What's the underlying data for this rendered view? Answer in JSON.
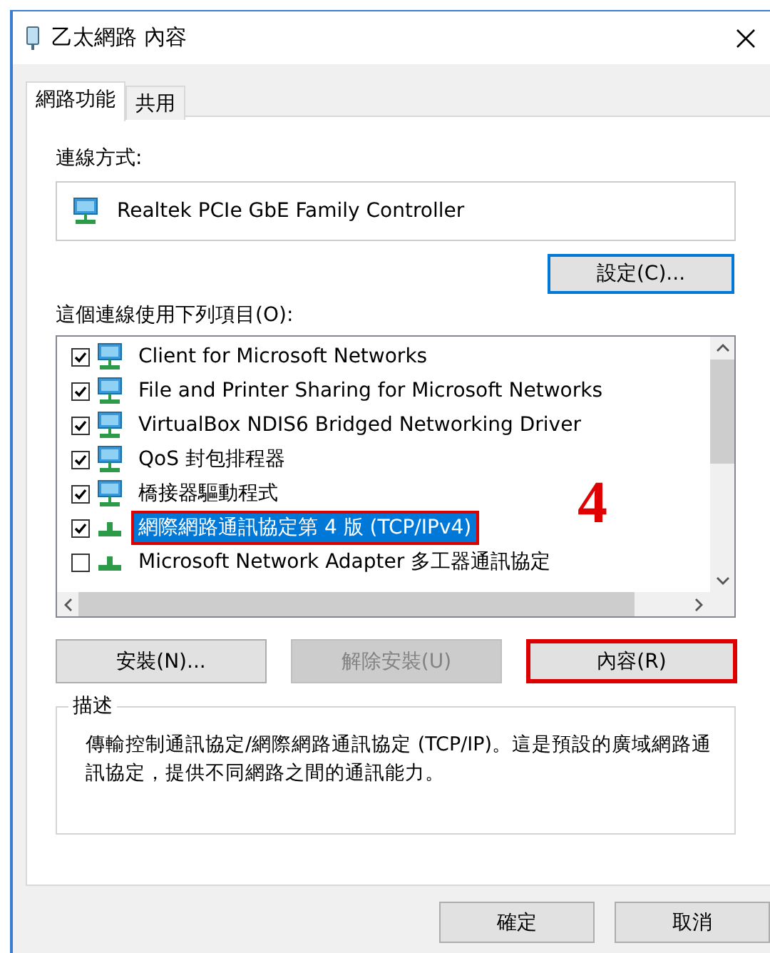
{
  "window": {
    "title": "乙太網路 內容"
  },
  "tabs": [
    {
      "label": "網路功能",
      "selected": true
    },
    {
      "label": "共用",
      "selected": false
    }
  ],
  "connect_using": {
    "label": "連線方式:",
    "adapter": "Realtek PCIe GbE Family Controller",
    "button": "設定(C)..."
  },
  "items": {
    "label": "這個連線使用下列項目(O):",
    "rows": [
      {
        "name": "Client for Microsoft Networks",
        "checked": true,
        "selected": false,
        "highlighted": false,
        "kind": "monitor"
      },
      {
        "name": "File and Printer Sharing for Microsoft Networks",
        "checked": true,
        "selected": false,
        "highlighted": false,
        "kind": "monitor"
      },
      {
        "name": "VirtualBox NDIS6 Bridged Networking Driver",
        "checked": true,
        "selected": false,
        "highlighted": false,
        "kind": "monitor"
      },
      {
        "name": "QoS 封包排程器",
        "checked": true,
        "selected": false,
        "highlighted": false,
        "kind": "monitor"
      },
      {
        "name": "橋接器驅動程式",
        "checked": true,
        "selected": false,
        "highlighted": false,
        "kind": "monitor"
      },
      {
        "name": "網際網路通訊協定第 4 版 (TCP/IPv4)",
        "checked": true,
        "selected": true,
        "highlighted": true,
        "kind": "protocol"
      },
      {
        "name": "Microsoft Network Adapter 多工器通訊協定",
        "checked": false,
        "selected": false,
        "highlighted": false,
        "kind": "protocol"
      }
    ]
  },
  "buttons": [
    {
      "label": "安裝(N)...",
      "disabled": false,
      "highlighted": false
    },
    {
      "label": "解除安裝(U)",
      "disabled": true,
      "highlighted": false
    },
    {
      "label": "內容(R)",
      "disabled": false,
      "highlighted": true
    }
  ],
  "description": {
    "label": "描述",
    "text": "傳輸控制通訊協定/網際網路通訊協定 (TCP/IP)。這是預設的廣域網路通訊協定，提供不同網路之間的通訊能力。"
  },
  "annotation": {
    "label": "4"
  },
  "dialog_buttons": [
    {
      "label": "確定"
    },
    {
      "label": "取消"
    }
  ]
}
